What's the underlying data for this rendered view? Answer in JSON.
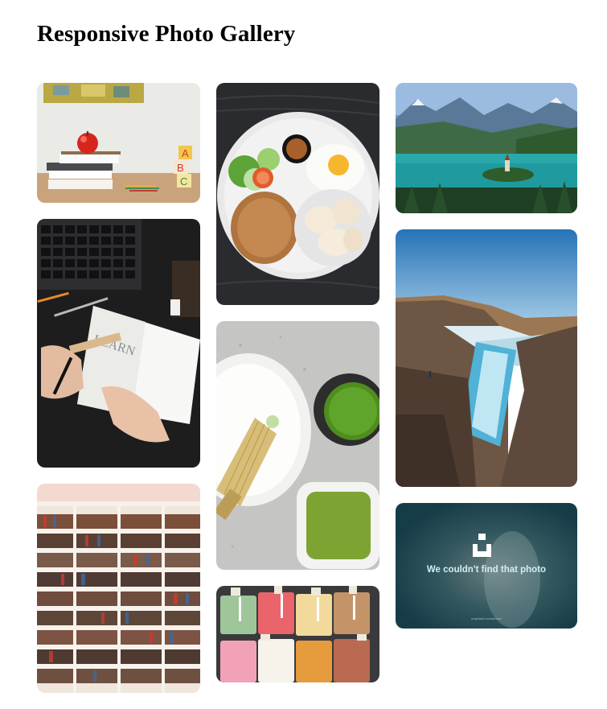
{
  "page": {
    "title": "Responsive Photo Gallery"
  },
  "gallery": {
    "columns": [
      {
        "photos": [
          "apple-books-desk",
          "notebook-learn-keyboard",
          "library-bookshelves"
        ]
      },
      {
        "photos": [
          "food-plate-rice",
          "matcha-tea-whisk",
          "gelato-trays"
        ]
      },
      {
        "photos": [
          "lake-bled-island",
          "waterfall-canyon",
          "unavailable-photo"
        ]
      }
    ],
    "notebook_text": "LEARN",
    "unavailable": {
      "message": "We couldn't find that photo",
      "small_text": "unsplash.com/photos"
    }
  },
  "colors": {
    "accent": "#000000",
    "background": "#ffffff"
  }
}
